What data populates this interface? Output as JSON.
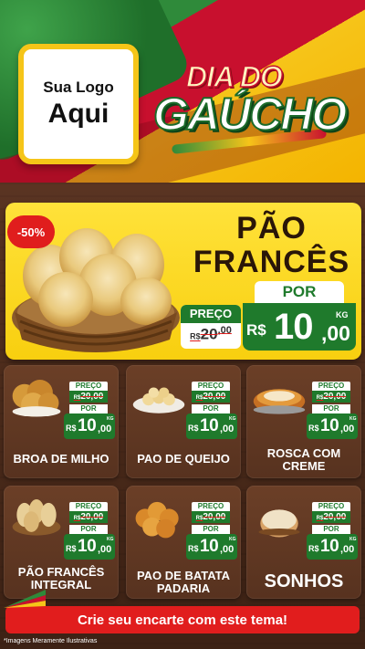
{
  "header": {
    "logo_line1": "Sua Logo",
    "logo_line2": "Aqui",
    "title_line1": "DIA DO",
    "title_line2": "GAÚCHO"
  },
  "hero": {
    "discount": "-50%",
    "product_line1": "PÃO",
    "product_line2": "FRANCÊS",
    "label_preco": "PREÇO",
    "label_por": "POR",
    "old_currency": "R$",
    "old_int": "20",
    "old_dec": ",00",
    "new_currency": "R$",
    "new_int": "10",
    "new_dec": ",00",
    "unit": "KG"
  },
  "products": [
    {
      "name": "BROA DE MILHO",
      "label_preco": "PREÇO",
      "old_currency": "R$",
      "old_value": "20,00",
      "label_por": "POR",
      "new_currency": "R$",
      "new_int": "10",
      "new_dec": ",00",
      "unit": "KG"
    },
    {
      "name": "PAO DE QUEIJO",
      "label_preco": "PREÇO",
      "old_currency": "R$",
      "old_value": "20,00",
      "label_por": "POR",
      "new_currency": "R$",
      "new_int": "10",
      "new_dec": ",00",
      "unit": "KG"
    },
    {
      "name": "ROSCA COM CREME",
      "label_preco": "PREÇO",
      "old_currency": "R$",
      "old_value": "20,00",
      "label_por": "POR",
      "new_currency": "R$",
      "new_int": "10",
      "new_dec": ",00",
      "unit": "KG"
    },
    {
      "name": "PÃO FRANCÊS INTEGRAL",
      "label_preco": "PREÇO",
      "old_currency": "R$",
      "old_value": "20,00",
      "label_por": "POR",
      "new_currency": "R$",
      "new_int": "10",
      "new_dec": ",00",
      "unit": "KG"
    },
    {
      "name": "PAO DE BATATA PADARIA",
      "label_preco": "PREÇO",
      "old_currency": "R$",
      "old_value": "20,00",
      "label_por": "POR",
      "new_currency": "R$",
      "new_int": "10",
      "new_dec": ",00",
      "unit": "KG"
    },
    {
      "name": "SONHOS",
      "label_preco": "PREÇO",
      "old_currency": "R$",
      "old_value": "20,00",
      "label_por": "POR",
      "new_currency": "R$",
      "new_int": "10",
      "new_dec": ",00",
      "unit": "KG"
    }
  ],
  "footer": {
    "cta": "Crie seu encarte com este tema!",
    "disclaimer": "*Imagens Meramente Ilustrativas"
  },
  "colors": {
    "flag_green": "#2f8a3a",
    "flag_red": "#c8102e",
    "flag_yellow": "#f6c419",
    "price_green": "#1f7a2c",
    "cta_red": "#e11d1d",
    "hero_yellow": "#f8cf0f"
  }
}
